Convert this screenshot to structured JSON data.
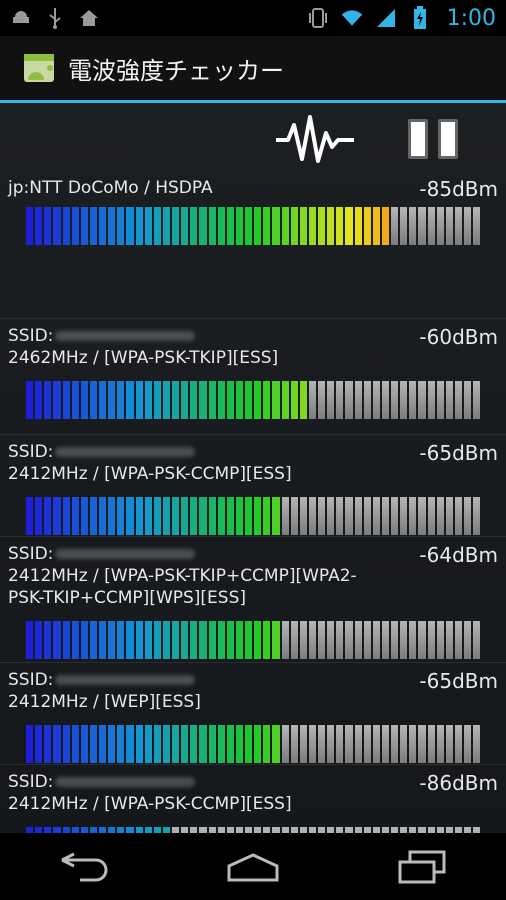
{
  "statusbar": {
    "time": "1:00",
    "left_icons": [
      "android-debug-icon",
      "usb-icon",
      "home-icon"
    ],
    "right_icons": [
      "vibrate-icon",
      "wifi-icon",
      "signal-icon",
      "battery-icon"
    ]
  },
  "app": {
    "title": "電波強度チェッカー"
  },
  "toolbar": {
    "pulse_icon": "pulse-icon",
    "pause_icon": "pause-icon"
  },
  "rows": [
    {
      "line1": "jp:NTT DoCoMo / HSDPA",
      "line2": "",
      "dbm": "-85dBm",
      "level": 0.8
    },
    {
      "line1": "SSID:",
      "line2": "2462MHz / [WPA-PSK-TKIP][ESS]",
      "dbm": "-60dBm",
      "level": 0.62
    },
    {
      "line1": "SSID:",
      "line2": "2412MHz / [WPA-PSK-CCMP][ESS]",
      "dbm": "-65dBm",
      "level": 0.56
    },
    {
      "line1": "SSID:",
      "line2": "2412MHz / [WPA-PSK-TKIP+CCMP][WPA2-",
      "line3": "PSK-TKIP+CCMP][WPS][ESS]",
      "dbm": "-64dBm",
      "level": 0.57
    },
    {
      "line1": "SSID:",
      "line2": "2412MHz / [WEP][ESS]",
      "dbm": "-65dBm",
      "level": 0.56
    },
    {
      "line1": "SSID:",
      "line2": "2412MHz / [WPA-PSK-CCMP][ESS]",
      "dbm": "-86dBm",
      "level": 0.32
    }
  ],
  "colors": {
    "accent": "#33b5e5",
    "empty_segment": "#9a9a9a"
  },
  "navbar": {
    "icons": [
      "back-icon",
      "home-icon",
      "recents-icon"
    ]
  }
}
